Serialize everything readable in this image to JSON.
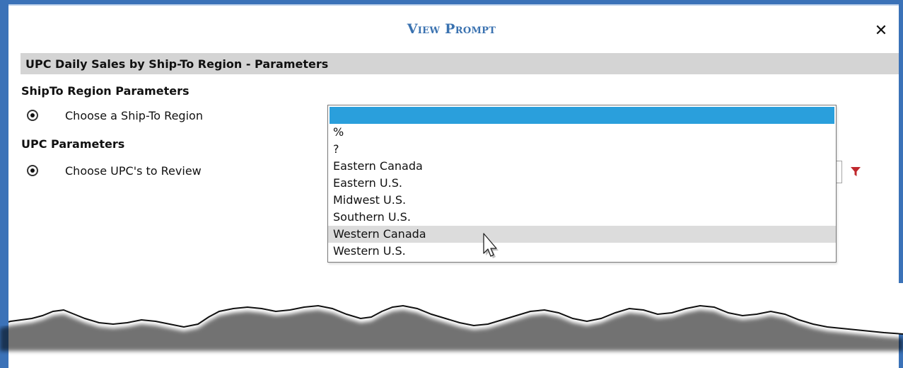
{
  "dialog": {
    "title": "View Prompt",
    "close_label": "✕"
  },
  "report": {
    "title": "UPC Daily Sales by Ship-To Region - Parameters"
  },
  "sections": {
    "region": {
      "title": "ShipTo Region Parameters",
      "param_label": "Choose a Ship-To Region"
    },
    "upc": {
      "title": "UPC Parameters",
      "param_label": "Choose UPC's to Review"
    }
  },
  "dropdown": {
    "selected_value": "",
    "options": [
      "%",
      "?",
      "Eastern Canada",
      "Eastern U.S.",
      "Midwest U.S.",
      "Southern U.S.",
      "Western Canada",
      "Western U.S."
    ],
    "hovered_option": "Western Canada"
  },
  "icons": {
    "close": "close-icon",
    "filter": "filter-icon",
    "cursor": "mouse-pointer-icon"
  },
  "colors": {
    "frame": "#3b72b8",
    "title": "#3a72b0",
    "selected_row": "#2a9fdc",
    "hover_row": "#dcdcdc",
    "report_bar": "#d4d4d4",
    "filter_icon": "#c0282d"
  }
}
